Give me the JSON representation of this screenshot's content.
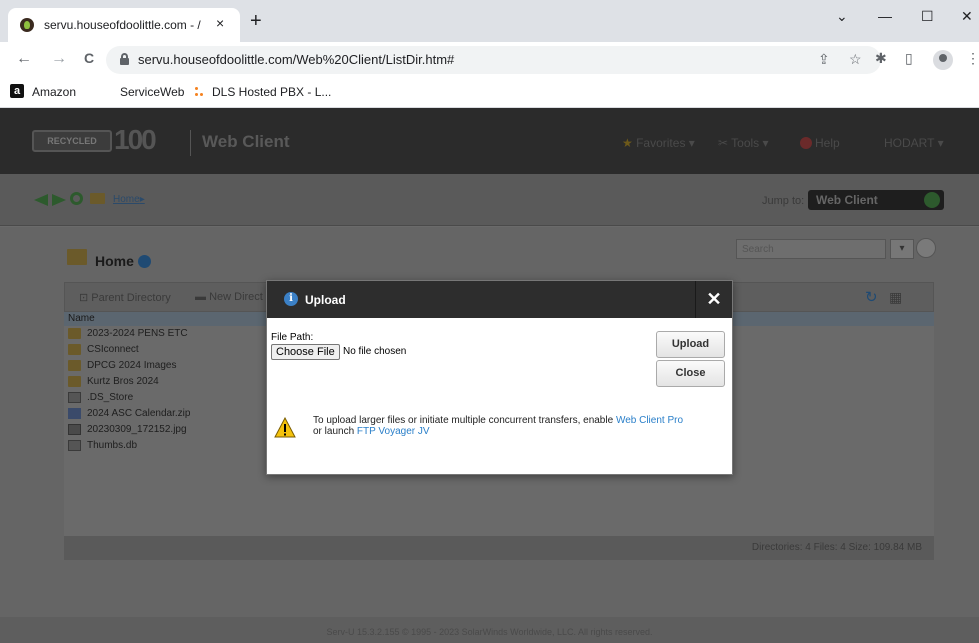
{
  "browser": {
    "tab_title": "servu.houseofdoolittle.com - /",
    "tab_close": "×",
    "new_tab": "+",
    "window_controls": {
      "minimize": "—",
      "maximize": "☐",
      "close": "✕",
      "menu": "⌄"
    },
    "nav": {
      "back": "←",
      "forward": "→",
      "reload": "C"
    },
    "url": "servu.houseofdoolittle.com/Web%20Client/ListDir.htm#",
    "omnibox_icons": {
      "share": "⇪",
      "star": "☆"
    },
    "toolbar_icons": {
      "extensions": "✱",
      "sidepanel": "▯",
      "menu": "⋮"
    },
    "bookmarks": [
      {
        "label": "Amazon",
        "icon": "a"
      },
      {
        "label": "ServiceWeb"
      },
      {
        "label": "DLS Hosted PBX - L..."
      }
    ]
  },
  "app": {
    "logo_badge": "RECYCLED",
    "logo_number": "100",
    "title": "Web Client",
    "menu": {
      "favorites": "Favorites ▾",
      "tools": "Tools ▾",
      "help": "Help",
      "user": "HODART ▾"
    },
    "breadcrumb": {
      "home": "Home",
      "sep": "▸"
    },
    "jump_to_label": "Jump to:",
    "jump_to_value": "Web Client",
    "heading": "Home",
    "search_placeholder": "Search",
    "search_dropdown": "▾",
    "list_toolbar": {
      "parent": "Parent Directory",
      "new_dir": "New Direct"
    },
    "column_name": "Name",
    "files": [
      {
        "name": "2023-2024 PENS ETC",
        "type": "folder"
      },
      {
        "name": "CSIconnect",
        "type": "folder"
      },
      {
        "name": "DPCG 2024 Images",
        "type": "folder"
      },
      {
        "name": "Kurtz Bros 2024",
        "type": "folder"
      },
      {
        "name": ".DS_Store",
        "type": "file"
      },
      {
        "name": "2024 ASC Calendar.zip",
        "type": "zip"
      },
      {
        "name": "20230309_172152.jpg",
        "type": "img"
      },
      {
        "name": "Thumbs.db",
        "type": "file"
      }
    ],
    "status": "Directories: 4   Files: 4   Size: 109.84 MB",
    "footer": "Serv-U 15.3.2.155 © 1995 - 2023 SolarWinds Worldwide, LLC. All rights reserved."
  },
  "modal": {
    "info_glyph": "i",
    "title": "Upload",
    "close": "✕",
    "file_path_label": "File Path:",
    "choose_file": "Choose File",
    "no_file": "No file chosen",
    "upload_btn": "Upload",
    "close_btn": "Close",
    "warning": {
      "pre": "To upload larger files or initiate multiple concurrent transfers, enable ",
      "link1": "Web Client Pro",
      "mid": " or launch ",
      "link2": "FTP Voyager JV"
    }
  }
}
